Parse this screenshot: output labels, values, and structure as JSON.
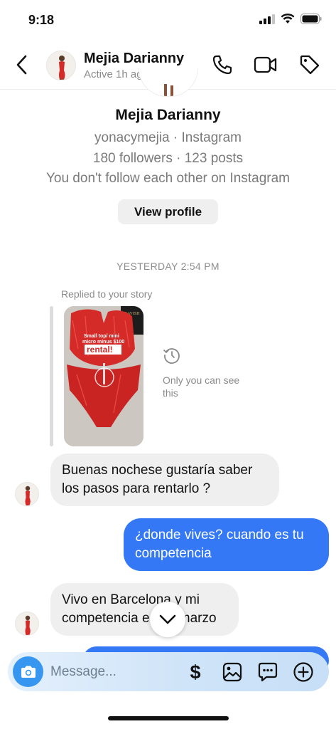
{
  "status_bar": {
    "time": "9:18"
  },
  "header": {
    "name": "Mejia Darianny",
    "status": "Active 1h ago"
  },
  "profile": {
    "name": "Mejia Darianny",
    "handle_line": "yonacymejia · Instagram",
    "stats_line": "180 followers · 123 posts",
    "follow_line": "You don't follow each other on Instagram",
    "view_profile_label": "View profile"
  },
  "thread": {
    "date_separator": "YESTERDAY 2:54 PM",
    "story_reply": {
      "label": "Replied to your story",
      "story_lines": [
        "Small top/ mini",
        "micro minus $100"
      ],
      "story_highlight": "rental!",
      "brand_text": "RAVISH",
      "hidden_note": "Only you can see this"
    },
    "messages": [
      {
        "from": "them",
        "text": "Buenas nochese gustaría saber los pasos para rentarlo ?"
      },
      {
        "from": "me",
        "text": "¿donde vives? cuando es tu competencia"
      },
      {
        "from": "them",
        "text": "Vivo en Barcelona y mi competencia es en marzo"
      }
    ]
  },
  "composer": {
    "placeholder": "Message..."
  },
  "icons": {
    "back": "chevron-left-icon",
    "call": "phone-icon",
    "video": "video-camera-icon",
    "tag": "tag-icon",
    "camera": "camera-icon",
    "payment": "dollar-icon",
    "gallery": "image-icon",
    "sticker": "chat-bubble-dots-icon",
    "more": "plus-circle-icon",
    "scroll": "chevron-down-icon"
  },
  "colors": {
    "accent_blue": "#3478f6",
    "camera_blue": "#3797f0",
    "incoming_bubble": "#efefef",
    "story_red": "#d42a28"
  }
}
